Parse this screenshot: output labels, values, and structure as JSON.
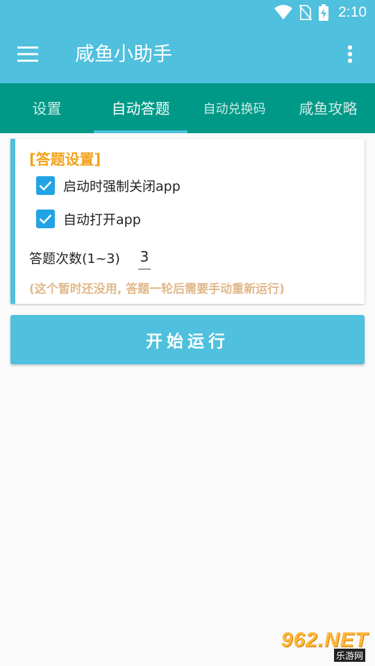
{
  "status_bar": {
    "time": "2:10",
    "icons": [
      "wifi-icon",
      "no-sim-icon",
      "battery-charging-icon"
    ],
    "color": "#4fc0dd"
  },
  "app_bar": {
    "title": "咸鱼小助手",
    "menu_icon": "hamburger-menu-icon",
    "more_icon": "more-vert-icon"
  },
  "tabs": [
    {
      "label": "设置",
      "active": false
    },
    {
      "label": "自动答题",
      "active": true
    },
    {
      "label": "自动兑换码",
      "active": false
    },
    {
      "label": "咸鱼攻略",
      "active": false
    }
  ],
  "settings": {
    "section_title": "[答题设置]",
    "checkboxes": [
      {
        "label": "启动时强制关闭app",
        "checked": true
      },
      {
        "label": "自动打开app",
        "checked": true
      }
    ],
    "count_label": "答题次数(1~3)",
    "count_value": "3",
    "hint": "(这个暂时还没用, 答题一轮后需要手动重新运行)"
  },
  "run_button_label": "开始运行",
  "watermark": {
    "main": "962.NET",
    "sub": "乐游网"
  },
  "colors": {
    "primary": "#4fc0dd",
    "tab_bar": "#009987",
    "accent_orange": "#f3a21b",
    "hint_text": "#e0b98b",
    "checkbox": "#21a3e6"
  }
}
